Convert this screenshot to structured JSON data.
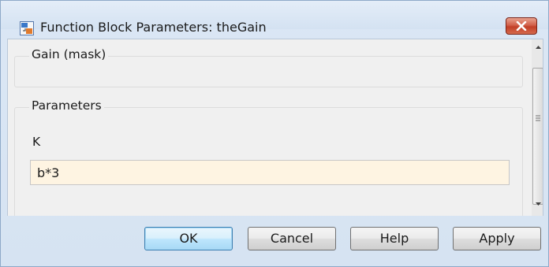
{
  "window": {
    "title": "Function Block Parameters: theGain",
    "close_icon": "close-icon",
    "app_icon": "simulink-block-icon"
  },
  "mask_group": {
    "title": "Gain (mask)"
  },
  "parameters_group": {
    "title": "Parameters",
    "fields": [
      {
        "label": "K",
        "value": "b*3"
      }
    ]
  },
  "scrollbar": {
    "up_icon": "scroll-up-icon",
    "down_icon": "scroll-down-icon",
    "grip_icon": "scroll-grip-icon"
  },
  "buttons": {
    "ok": "OK",
    "cancel": "Cancel",
    "help": "Help",
    "apply": "Apply"
  },
  "colors": {
    "input_background": "#fef4e2",
    "close_button": "#c94a32",
    "default_button_border": "#3c7fb1"
  }
}
